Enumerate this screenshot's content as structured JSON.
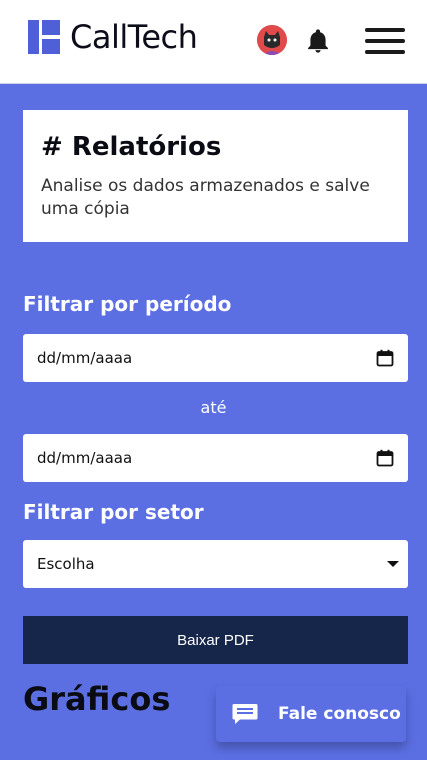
{
  "header": {
    "logo_text": "CallTech",
    "avatar_icon": "user-avatar",
    "notification_icon": "bell-icon",
    "menu_icon": "hamburger-icon"
  },
  "card": {
    "title": "# Relatórios",
    "subtitle": "Analise os dados armazenados e salve uma cópia"
  },
  "filters": {
    "period_label": "Filtrar por período",
    "date_start_placeholder": "dd/mm/aaaa",
    "between_text": "até",
    "date_end_placeholder": "dd/mm/aaaa",
    "sector_label": "Filtrar por setor",
    "sector_selected": "Escolha"
  },
  "actions": {
    "download_pdf_label": "Baixar PDF"
  },
  "charts_section": {
    "title": "Gráficos"
  },
  "chat_widget": {
    "label": "Fale conosco",
    "icon": "chat-icon"
  },
  "colors": {
    "background": "#5b6fe3",
    "button_dark": "#16264a",
    "brand": "#4f5fd8"
  }
}
